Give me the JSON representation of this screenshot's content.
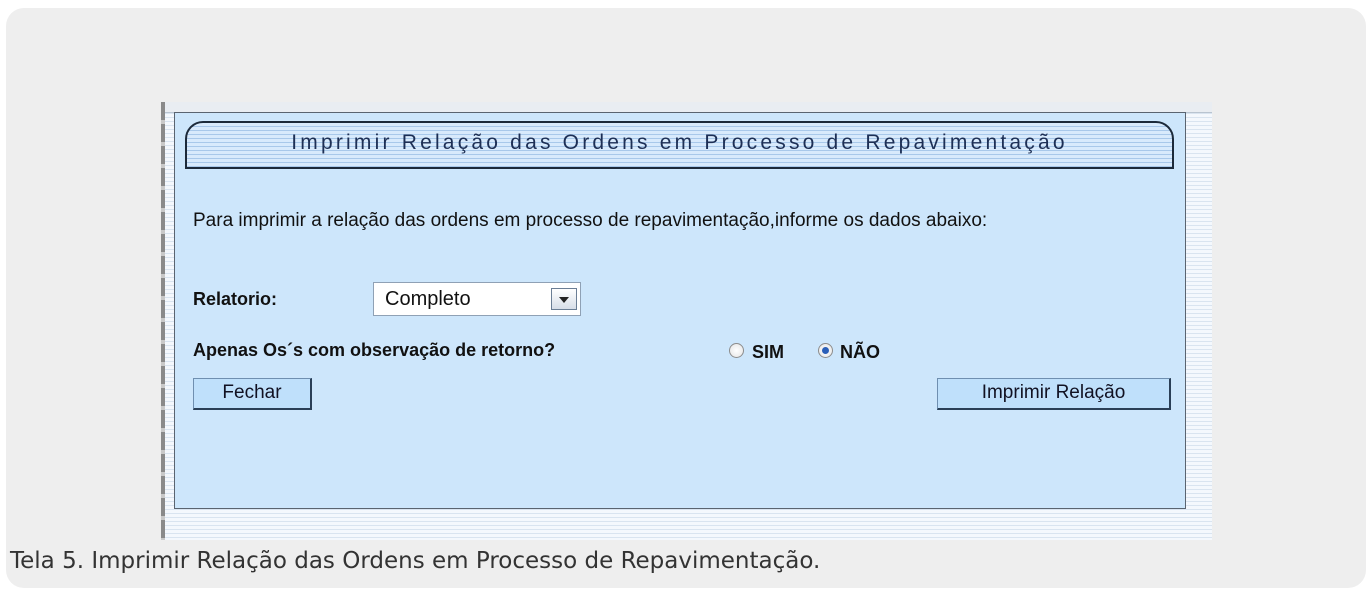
{
  "form": {
    "title": "Imprimir Relação das Ordens em Processo de Repavimentação",
    "intro": "Para imprimir a relação das ordens em processo de repavimentação,informe os dados abaixo:",
    "relatorio_label": "Relatorio:",
    "relatorio_value": "Completo",
    "observacao_label": "Apenas Os´s com observação de retorno?",
    "radio_sim_label": "SIM",
    "radio_nao_label": "NÃO",
    "selected_option": "NÃO",
    "close_button": "Fechar",
    "print_button": "Imprimir Relação"
  },
  "caption": "Tela 5. Imprimir Relação das Ordens em Processo de Repavimentação."
}
